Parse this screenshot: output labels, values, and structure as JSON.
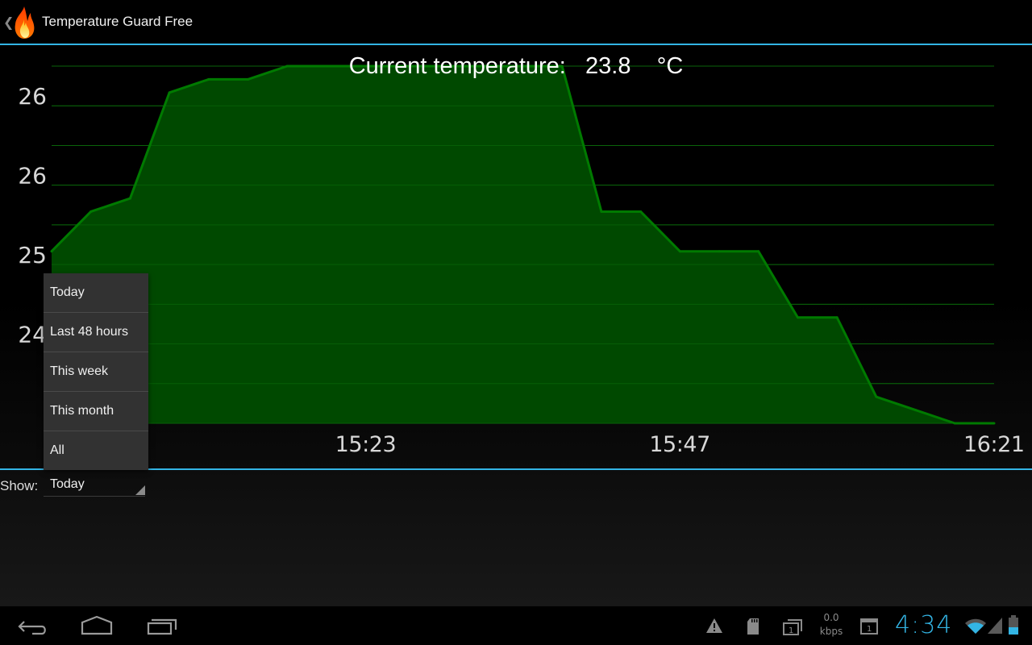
{
  "action_bar": {
    "title": "Temperature Guard Free",
    "icon": "flame-icon"
  },
  "current_temperature": {
    "label": "Current temperature:",
    "value": "23.8",
    "unit": "°C"
  },
  "chart_data": {
    "type": "area",
    "title": "Current temperature: 23.8 °C",
    "xlabel": "",
    "ylabel": "",
    "x_tick_labels": [
      "15:23",
      "15:47",
      "16:21"
    ],
    "y_tick_labels": [
      "26",
      "26",
      "25",
      "24"
    ],
    "y_tick_values": [
      26.2,
      25.6,
      25.0,
      24.4
    ],
    "ylim": [
      23.8,
      26.5
    ],
    "grid": true,
    "series": [
      {
        "name": "Temperature",
        "values": [
          25.1,
          25.4,
          25.5,
          26.3,
          26.4,
          26.4,
          26.5,
          26.5,
          26.5,
          26.5,
          26.5,
          26.5,
          26.5,
          26.5,
          25.4,
          25.4,
          25.1,
          25.1,
          25.1,
          24.6,
          24.6,
          24.0,
          23.9,
          23.8,
          23.8
        ]
      }
    ],
    "colors": {
      "fill": "#004d00",
      "line": "#007a00",
      "grid": "#0a5a0a"
    }
  },
  "bottom_panel": {
    "show_label": "Show:",
    "spinner_value": "Today"
  },
  "dropdown": {
    "options": [
      "Today",
      "Last 48 hours",
      "This week",
      "This month",
      "All"
    ]
  },
  "status_bar": {
    "net_speed_value": "0.0",
    "net_speed_unit": "kbps",
    "clock": "4:34",
    "icons": [
      "warning-icon",
      "sd-card-icon",
      "notification-stack-icon",
      "calendar-icon",
      "wifi-icon",
      "cell-signal-icon",
      "battery-icon"
    ]
  },
  "nav_bar": {
    "buttons": [
      "back-button",
      "home-button",
      "recent-apps-button"
    ]
  },
  "colors": {
    "accent": "#33b5e5",
    "chart_fill": "#004d00",
    "chart_line": "#007a00"
  }
}
